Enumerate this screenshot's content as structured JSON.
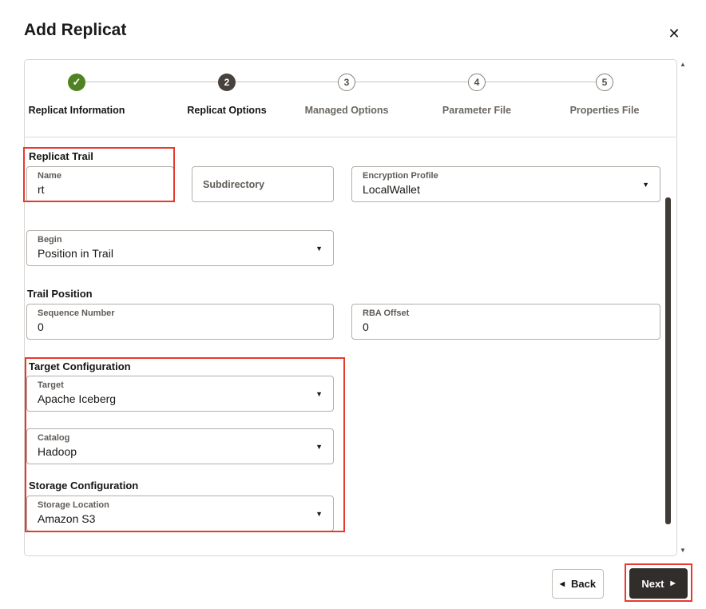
{
  "dialog": {
    "title": "Add Replicat"
  },
  "icons": {
    "close": "✕",
    "check": "✓",
    "dropdown_caret": "▼",
    "back_arrow": "◀",
    "next_arrow": "▶",
    "scroll_up": "▲",
    "scroll_down": "▼"
  },
  "stepper": {
    "steps": [
      {
        "indicator": "✓",
        "label": "Replicat Information",
        "state": "complete"
      },
      {
        "indicator": "2",
        "label": "Replicat Options",
        "state": "active"
      },
      {
        "indicator": "3",
        "label": "Managed Options",
        "state": "upcoming"
      },
      {
        "indicator": "4",
        "label": "Parameter File",
        "state": "upcoming"
      },
      {
        "indicator": "5",
        "label": "Properties File",
        "state": "upcoming"
      }
    ]
  },
  "form": {
    "replicat_trail": {
      "heading": "Replicat Trail",
      "name": {
        "label": "Name",
        "value": "rt"
      },
      "subdirectory": {
        "label": "Subdirectory",
        "value": ""
      },
      "encryption_profile": {
        "label": "Encryption Profile",
        "value": "LocalWallet"
      }
    },
    "begin": {
      "label": "Begin",
      "value": "Position in Trail"
    },
    "trail_position": {
      "heading": "Trail Position",
      "sequence_number": {
        "label": "Sequence Number",
        "value": "0"
      },
      "rba_offset": {
        "label": "RBA Offset",
        "value": "0"
      }
    },
    "target_configuration": {
      "heading": "Target Configuration",
      "target": {
        "label": "Target",
        "value": "Apache Iceberg"
      },
      "catalog": {
        "label": "Catalog",
        "value": "Hadoop"
      }
    },
    "storage_configuration": {
      "heading": "Storage Configuration",
      "storage_location": {
        "label": "Storage Location",
        "value": "Amazon S3"
      }
    }
  },
  "footer": {
    "back_label": "Back",
    "next_label": "Next"
  },
  "colors": {
    "accent_green": "#508223",
    "active_step_bg": "#47423d",
    "annotation_red": "#e8392d",
    "primary_button_bg": "#312d2a"
  }
}
